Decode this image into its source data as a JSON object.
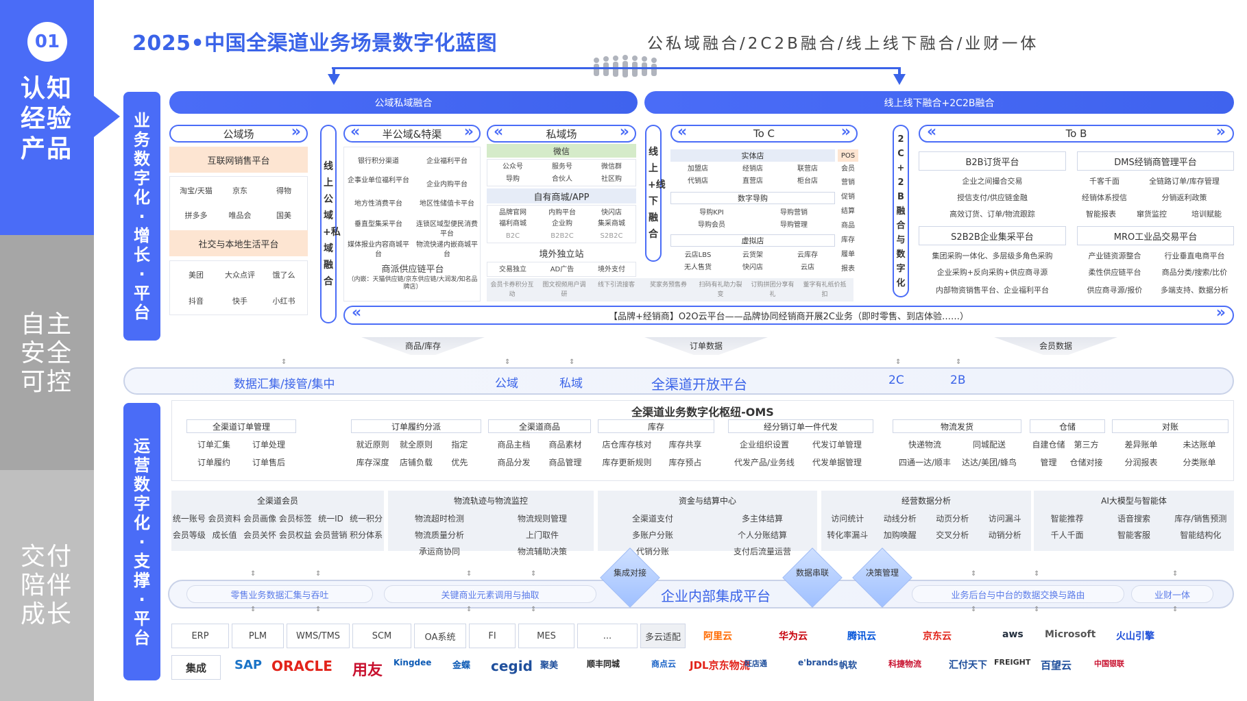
{
  "nav": {
    "num": "01",
    "s1": [
      "认知",
      "经验",
      "产品"
    ],
    "s2": [
      "自主",
      "安全",
      "可控"
    ],
    "s3": [
      "交付",
      "陪伴",
      "成长"
    ]
  },
  "title": "2025•中国全渠道业务场景数字化蓝图",
  "subtitle": "公私域融合/2C2B融合/线上线下融合/业财一体",
  "vbar_top": "业务数字化·增长·平台",
  "vbar_bottom": "运营数字化·支撑·平台",
  "banners": {
    "left": "公域私域融合",
    "right": "线上线下融合+2C2B融合"
  },
  "public": {
    "header": "公域场",
    "sec1": "互联网销售平台",
    "sec1_items": [
      "淘宝/天猫",
      "京东",
      "得物",
      "拼多多",
      "唯品会",
      "国美"
    ],
    "sec2": "社交与本地生活平台",
    "sec2_items": [
      "美团",
      "大众点评",
      "饿了么",
      "抖音",
      "快手",
      "小红书"
    ]
  },
  "vpill1": "线上公域+私域融合",
  "semi": {
    "header": "半公域&特渠",
    "items": [
      "银行积分渠道",
      "企业福利平台",
      "企事业单位福利平台",
      "企业内购平台",
      "地方性消费平台",
      "地区性储值卡平台",
      "垂直型集采平台",
      "连锁区域型便民消费平台",
      "媒体报业内容商城平台",
      "物流快递内嵌商城平台"
    ],
    "bottom": "商派供应链平台",
    "bottom_sub": "（内嵌：天猫供应链/京东供应链/大润发/知名品牌店）"
  },
  "private": {
    "header": "私域场",
    "wechat": "微信",
    "wechat_items": [
      "公众号",
      "服务号",
      "微信群",
      "导购",
      "合伙人",
      "社区购"
    ],
    "mall": "自有商城/APP",
    "mall_items": [
      "品牌官网",
      "内购平台",
      "快闪店",
      "福利商城",
      "企业购",
      "集采商城",
      "B2C",
      "B2B2C",
      "S2B2C"
    ],
    "indep": "境外独立站",
    "indep_items": [
      "交易独立",
      "AD广告",
      "境外支付"
    ],
    "bottom_items": [
      "会员卡券积分互动",
      "图文视频用户调研",
      "线下引流接客",
      "奖家务预售券",
      "扫码有礼助力裂变",
      "订购拼团分享有礼",
      "董字有礼纸价抵扣"
    ]
  },
  "vpill2": "线上+线下融合",
  "toc": {
    "header": "To C",
    "entity": "实体店",
    "entity_items": [
      "加盟店",
      "经销店",
      "联营店",
      "代销店",
      "直营店",
      "柜台店"
    ],
    "pos": "POS",
    "pos_items": [
      "会员",
      "营销",
      "促销",
      "结算",
      "商品",
      "库存",
      "履单",
      "报表"
    ],
    "guide": "数字导购",
    "guide_items": [
      "导购KPI",
      "导购营销",
      "导购会员",
      "导购管理"
    ],
    "virtual": "虚拟店",
    "virtual_items": [
      "云店LBS",
      "云货架",
      "云库存",
      "无人售货",
      "快闪店",
      "云店"
    ]
  },
  "vpill3": "2C+2B融合与数字化",
  "tob": {
    "header": "To B",
    "b2b": "B2B订货平台",
    "b2b_items": [
      "企业之间撮合交易",
      "授信支付/供应链金融",
      "高效订货、订单/物流跟踪"
    ],
    "dms": "DMS经销商管理平台",
    "dms_items": [
      "千客千面",
      "全链路订单/库存管理",
      "经销体系授信",
      "分销返利政策",
      "智能报表",
      "窜货监控",
      "培训赋能"
    ],
    "s2b2b": "S2B2B企业集采平台",
    "s2b2b_items": [
      "集团采购一体化、多层级多角色采购",
      "企业采购+反向采购+供应商寻源",
      "内部物资销售平台、企业福利平台"
    ],
    "mro": "MRO工业品交易平台",
    "mro_items": [
      "产业链资源整合",
      "行业垂直电商平台",
      "柔性供应链平台",
      "商品分类/搜索/比价",
      "供应商寻源/报价",
      "多端支持、数据分析"
    ]
  },
  "o2o": "【品牌+经销商】O2O云平台——品牌协同经销商开展2C业务（即时零售、到店体验……）",
  "funnels": [
    "商品/库存",
    "订单数据",
    "会员数据"
  ],
  "platform": {
    "left": "数据汇集/接管/集中",
    "public": "公域",
    "private": "私域",
    "center": "全渠道开放平台",
    "c2": "2C",
    "b2": "2B"
  },
  "oms": {
    "title": "全渠道业务数字化枢纽-OMS",
    "groups": [
      {
        "title": "全渠道订单管理",
        "items": [
          "订单汇集",
          "订单处理",
          "订单履约",
          "订单售后"
        ]
      },
      {
        "title": "订单履约分派",
        "items": [
          "就近原则",
          "就全原则",
          "指定",
          "库存深度",
          "店铺负载",
          "优先"
        ]
      },
      {
        "title": "全渠道商品",
        "items": [
          "商品主档",
          "商品素材",
          "商品分发",
          "商品管理"
        ]
      },
      {
        "title": "库存",
        "items": [
          "店仓库存核对",
          "库存共享",
          "库存更新规则",
          "库存预占"
        ]
      },
      {
        "title": "经分销订单一件代发",
        "items": [
          "企业组织设置",
          "代发订单管理",
          "代发产品/业务线",
          "代发单据管理"
        ]
      },
      {
        "title": "物流发货",
        "items": [
          "快递物流",
          "同城配送",
          "四通一达/顺丰",
          "达达/美团/蜂鸟"
        ]
      },
      {
        "title": "仓储",
        "items": [
          "自建仓储",
          "第三方",
          "管理",
          "仓储对接"
        ]
      },
      {
        "title": "对账",
        "items": [
          "差异账单",
          "未达账单",
          "分润报表",
          "分类账单"
        ]
      }
    ]
  },
  "ops": [
    {
      "title": "全渠道会员",
      "items": [
        "统一账号",
        "会员资料",
        "会员画像",
        "会员标签",
        "统一ID",
        "统一积分",
        "会员等级",
        "成长值",
        "会员关怀",
        "会员权益",
        "会员营销",
        "积分体系"
      ]
    },
    {
      "title": "物流轨迹与物流监控",
      "items": [
        "物流超时检测",
        "物流规则管理",
        "物流质量分析",
        "上门取件",
        "承运商协同",
        "物流辅助决策"
      ]
    },
    {
      "title": "资金与结算中心",
      "items": [
        "全渠道支付",
        "多主体结算",
        "多账户分账",
        "个人分账结算",
        "代销分账",
        "支付后流量运营"
      ]
    },
    {
      "title": "经营数据分析",
      "items": [
        "访问统计",
        "动线分析",
        "动页分析",
        "访问漏斗",
        "转化率漏斗",
        "加购唤醒",
        "交叉分析",
        "动销分析"
      ]
    },
    {
      "title": "AI大模型与智能体",
      "items": [
        "智能推荐",
        "语音搜索",
        "库存/销售预测",
        "千人千面",
        "智能客服",
        "智能结构化"
      ]
    }
  ],
  "integration": {
    "retail": "零售业务数据汇集与吞吐",
    "key": "关键商业元素调用与抽取",
    "center": "企业内部集成平台",
    "backend": "业务后台与中台的数据交换与路由",
    "finance": "业财一体",
    "diamonds": [
      "集成对接",
      "数据串联",
      "决策管理"
    ]
  },
  "systems": [
    "ERP",
    "PLM",
    "WMS/TMS",
    "SCM",
    "OA系统",
    "FI",
    "MES",
    "...",
    "多云适配"
  ],
  "clouds": [
    "阿里云",
    "华为云",
    "腾讯云",
    "京东云",
    "aws",
    "Microsoft",
    "火山引擎"
  ],
  "integ_label": "集成",
  "vendors": [
    "SAP",
    "ORACLE",
    "用友",
    "Kingdee",
    "金蝶",
    "cegid",
    "聚美",
    "顺丰同城",
    "商点云",
    "JDL京东物流",
    "旺店通",
    "e'brands",
    "帆软",
    "科捷物流",
    "汇付天下",
    "FREIGHT",
    "百望云",
    "中国银联"
  ],
  "colors": {
    "accent": "#4a6cf7",
    "gray1": "#a6a6a6",
    "gray2": "#bfbfbf",
    "peach": "#fde5d2"
  }
}
